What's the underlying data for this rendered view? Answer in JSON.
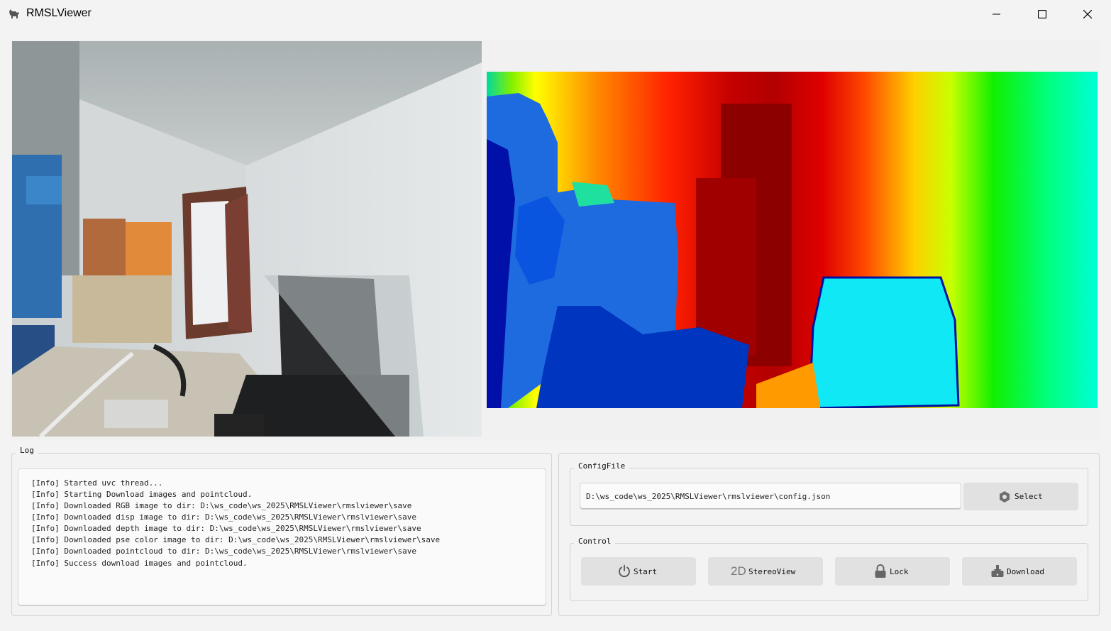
{
  "window": {
    "title": "RMSLViewer",
    "controls": [
      "minimize-icon",
      "maximize-icon",
      "close-icon"
    ]
  },
  "log": {
    "title": "Log",
    "lines": [
      "[Info] Started uvc thread...",
      "[Info] Starting Download images and pointcloud.",
      "[Info] Downloaded RGB image to dir: D:\\ws_code\\ws_2025\\RMSLViewer\\rmslviewer\\save",
      "[Info] Downloaded disp image to dir: D:\\ws_code\\ws_2025\\RMSLViewer\\rmslviewer\\save",
      "[Info] Downloaded depth image to dir: D:\\ws_code\\ws_2025\\RMSLViewer\\rmslviewer\\save",
      "[Info] Downloaded pse color image to dir: D:\\ws_code\\ws_2025\\RMSLViewer\\rmslviewer\\save",
      "[Info] Downloaded pointcloud to dir: D:\\ws_code\\ws_2025\\RMSLViewer\\rmslviewer\\save",
      "[Info] Success download images and pointcloud."
    ]
  },
  "config": {
    "title": "ConfigFile",
    "path": "D:\\ws_code\\ws_2025\\RMSLViewer\\rmslviewer\\config.json",
    "select_label": "Select",
    "select_icon": "hexagon-icon"
  },
  "control": {
    "title": "Control",
    "buttons": [
      {
        "label": "Start",
        "icon": "power-icon"
      },
      {
        "label": "StereoView",
        "icon": "2d-icon",
        "icon_text": "2D"
      },
      {
        "label": "Lock",
        "icon": "lock-icon"
      },
      {
        "label": "Download",
        "icon": "download-icon"
      }
    ]
  },
  "colors": {
    "background": "#f3f3f3",
    "button": "#e1e1e1",
    "depth_near": "#0000a0",
    "depth_far": "#00ffd0"
  }
}
